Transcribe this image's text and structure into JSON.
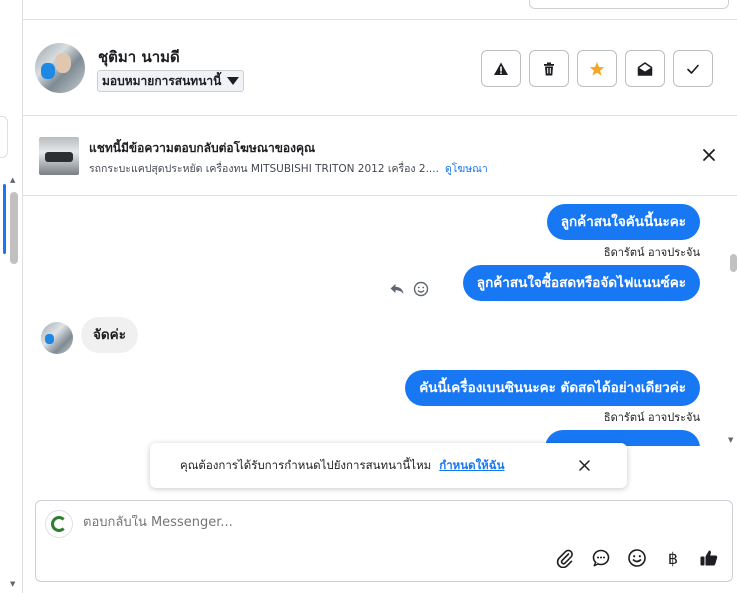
{
  "header": {
    "contact_name": "ชุติมา นามดี",
    "assign_label": "มอบหมายการสนทนานี้",
    "buttons": [
      {
        "name": "report-spam-button",
        "icon": "warning-icon"
      },
      {
        "name": "delete-button",
        "icon": "trash-icon"
      },
      {
        "name": "star-button",
        "icon": "star-icon",
        "color": "#f5a623"
      },
      {
        "name": "mark-unread-button",
        "icon": "envelope-open-icon"
      },
      {
        "name": "mark-done-button",
        "icon": "check-icon"
      }
    ]
  },
  "ad_banner": {
    "title": "แชทนี้มีข้อความตอบกลับต่อโฆษณาของคุณ",
    "description": "รถกระบะแคปสุดประหยัด เครื่องทน MITSUBISHI TRITON 2012 เครื่อง 2....",
    "view_ad_link": "ดูโฆษณา"
  },
  "messages": [
    {
      "direction": "out",
      "text": "ลูกค้าสนใจคันนี้นะคะ",
      "sender": "ธิดารัตน์ อาจประจัน"
    },
    {
      "direction": "out",
      "text": "ลูกค้าสนใจซื้อสดหรือจัดไฟแนนซ์คะ"
    },
    {
      "direction": "in",
      "text": "จัดค่ะ"
    },
    {
      "direction": "out",
      "text": "คันนี้เครื่องเบนซินนะคะ ตัดสดได้อย่างเดียวค่ะ",
      "sender": "ธิดารัตน์ อาจประจัน"
    },
    {
      "direction": "out",
      "text": "...",
      "partial": true
    }
  ],
  "toast": {
    "text": "คุณต้องการได้รับการกำหนดไปยังการสนทนานี้ไหม",
    "link": "กำหนดให้ฉัน"
  },
  "composer": {
    "placeholder": "ตอบกลับใน Messenger...",
    "tools": [
      "paperclip-icon",
      "chat-bubble-icon",
      "emoji-icon",
      "baht-icon",
      "thumbs-up-icon"
    ],
    "baht_symbol": "฿"
  },
  "colors": {
    "accent": "#1877f2",
    "star": "#f5a623",
    "incoming_bubble": "#f0f0f0"
  }
}
